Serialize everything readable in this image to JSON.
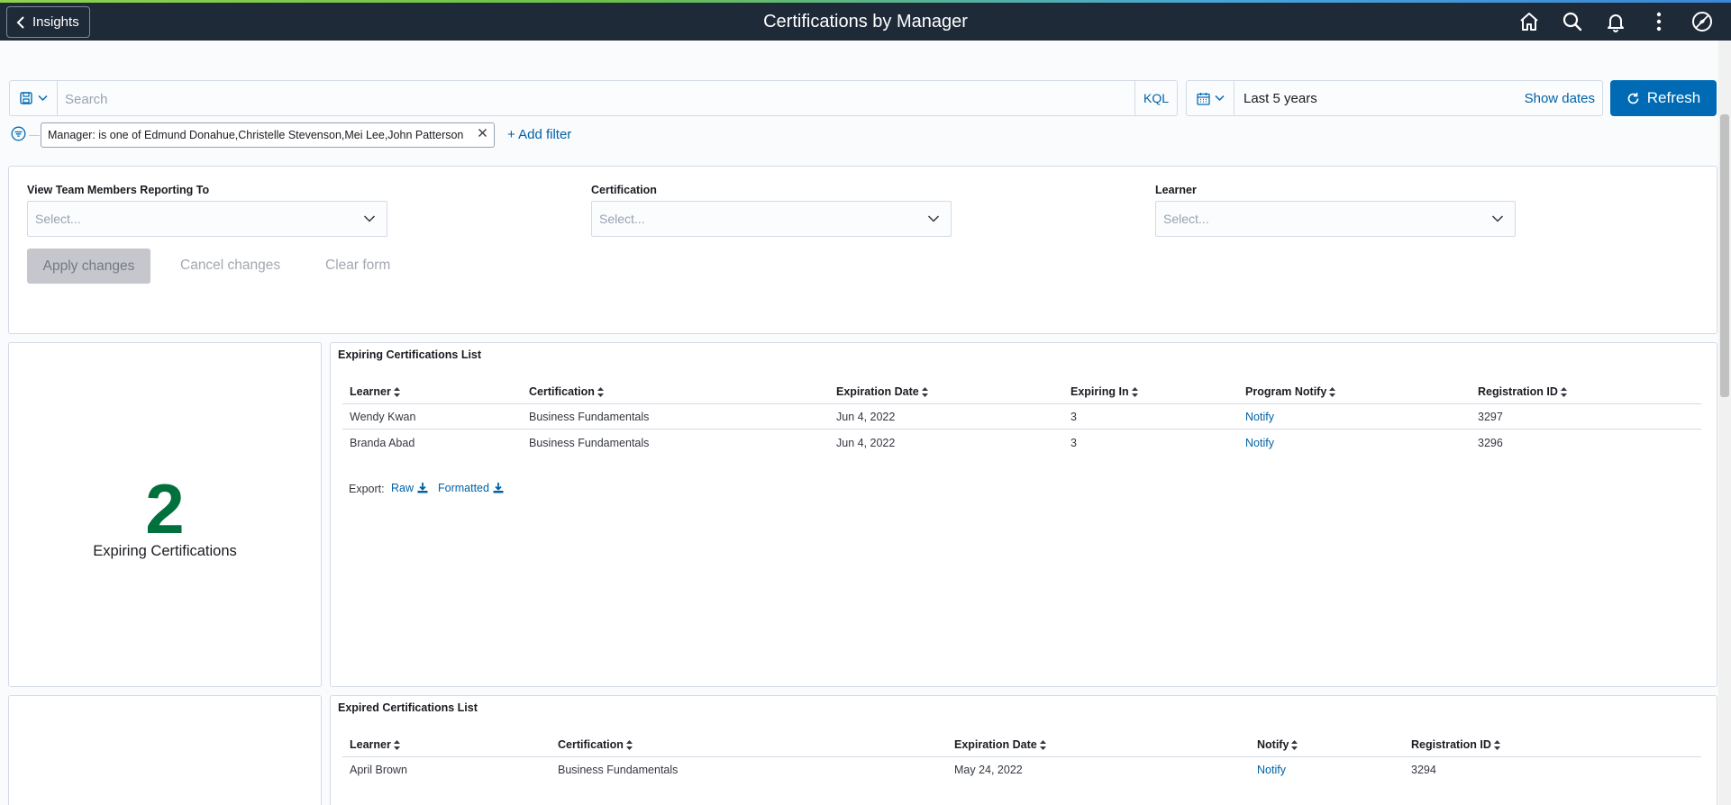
{
  "header": {
    "back_label": "Insights",
    "title": "Certifications by Manager",
    "icons": [
      "home-icon",
      "search-icon",
      "bell-icon",
      "more-vertical-icon",
      "compass-icon"
    ]
  },
  "query_bar": {
    "search_placeholder": "Search",
    "search_value": "",
    "kql_label": "KQL",
    "date_range": "Last 5 years",
    "show_dates_label": "Show dates",
    "refresh_label": "Refresh"
  },
  "filters": {
    "pill_label": "Manager: is one of Edmund Donahue,Christelle Stevenson,Mei Lee,John Patterson",
    "add_filter_label": "+ Add filter"
  },
  "controls": {
    "fields": [
      {
        "label": "View Team Members Reporting To",
        "placeholder": "Select..."
      },
      {
        "label": "Certification",
        "placeholder": "Select..."
      },
      {
        "label": "Learner",
        "placeholder": "Select..."
      }
    ],
    "apply_label": "Apply changes",
    "cancel_label": "Cancel changes",
    "clear_label": "Clear form"
  },
  "metric": {
    "value": "2",
    "label": "Expiring Certifications"
  },
  "expiring_table": {
    "title": "Expiring Certifications List",
    "columns": [
      "Learner",
      "Certification",
      "Expiration Date",
      "Expiring In",
      "Program Notify",
      "Registration ID"
    ],
    "rows": [
      [
        "Wendy Kwan",
        "Business Fundamentals",
        "Jun 4, 2022",
        "3",
        "Notify",
        "3297"
      ],
      [
        "Branda Abad",
        "Business Fundamentals",
        "Jun 4, 2022",
        "3",
        "Notify",
        "3296"
      ]
    ],
    "export_label": "Export:",
    "export_raw": "Raw",
    "export_formatted": "Formatted"
  },
  "expired_table": {
    "title": "Expired Certifications List",
    "columns": [
      "Learner",
      "Certification",
      "Expiration Date",
      "Notify",
      "Registration ID"
    ],
    "rows": [
      [
        "April Brown",
        "Business Fundamentals",
        "May 24, 2022",
        "Notify",
        "3294"
      ]
    ]
  }
}
